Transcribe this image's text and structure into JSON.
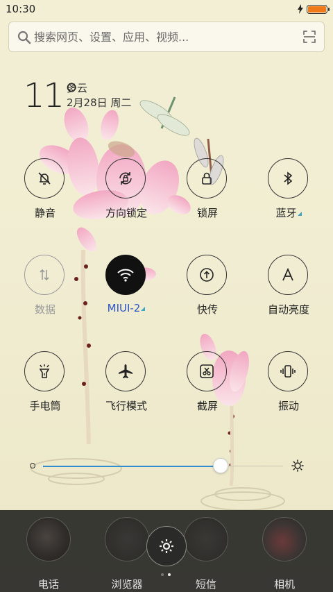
{
  "status_bar": {
    "time": "10:30",
    "battery_level": 1.0
  },
  "search": {
    "placeholder": "搜索网页、设置、应用、视频..."
  },
  "weather": {
    "temperature": "11°",
    "condition": "多云",
    "date": "2月28日 周二"
  },
  "toggles": [
    {
      "label": "静音",
      "icon": "bell-off-icon",
      "state": "off"
    },
    {
      "label": "方向锁定",
      "icon": "rotation-lock-icon",
      "state": "off"
    },
    {
      "label": "锁屏",
      "icon": "lock-icon",
      "state": "off"
    },
    {
      "label": "蓝牙",
      "icon": "bluetooth-icon",
      "state": "off",
      "has_submenu": true
    },
    {
      "label": "数据",
      "icon": "mobile-data-icon",
      "state": "disabled"
    },
    {
      "label": "MIUI-2",
      "icon": "wifi-icon",
      "state": "on",
      "has_submenu": true
    },
    {
      "label": "快传",
      "icon": "quick-transfer-icon",
      "state": "off"
    },
    {
      "label": "自动亮度",
      "icon": "auto-brightness-icon",
      "state": "off"
    },
    {
      "label": "手电筒",
      "icon": "flashlight-icon",
      "state": "off"
    },
    {
      "label": "飞行模式",
      "icon": "airplane-icon",
      "state": "off"
    },
    {
      "label": "截屏",
      "icon": "screenshot-icon",
      "state": "off"
    },
    {
      "label": "振动",
      "icon": "vibrate-icon",
      "state": "off"
    }
  ],
  "brightness": {
    "level": 0.74
  },
  "dock": {
    "apps": [
      {
        "label": "电话",
        "icon": "phone-icon"
      },
      {
        "label": "浏览器",
        "icon": "browser-icon"
      },
      {
        "label": "短信",
        "icon": "messages-icon"
      },
      {
        "label": "相机",
        "icon": "camera-icon"
      }
    ],
    "settings_icon": "gear-icon",
    "page_count": 2,
    "current_page": 2
  },
  "colors": {
    "accent": "#2f8fd0",
    "active_label": "#2b54c9",
    "battery": "#f07a1a"
  }
}
